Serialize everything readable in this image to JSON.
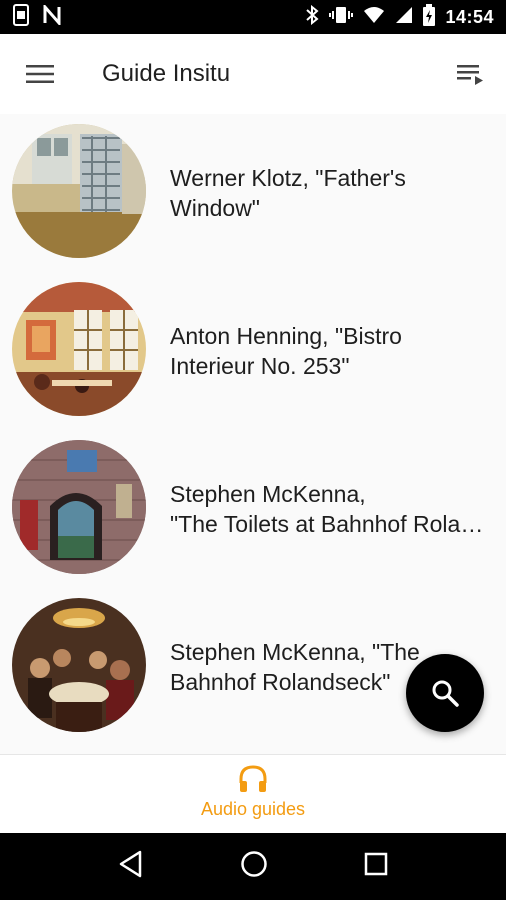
{
  "status_bar": {
    "time": "14:54",
    "icons": [
      "screenshot-icon",
      "n-icon",
      "bluetooth-icon",
      "vibrate-icon",
      "wifi-icon",
      "signal-icon",
      "battery-charging-icon"
    ]
  },
  "app_bar": {
    "title": "Guide Insitu",
    "menu_icon": "menu-icon",
    "playlist_icon": "playlist-icon"
  },
  "items": [
    {
      "line1": "Werner Klotz, \"Father's",
      "line2": "Window\""
    },
    {
      "line1": "Anton Henning, \"Bistro",
      "line2": "Interieur No. 253\""
    },
    {
      "line1": "Stephen McKenna,",
      "line2": "\"The Toilets at Bahnhof Rolandseck\""
    },
    {
      "line1": "Stephen McKenna, \"The",
      "line2": "Bahnhof Rolandseck\""
    }
  ],
  "fab": {
    "icon": "search-icon"
  },
  "bottom_nav": {
    "label": "Audio guides",
    "icon": "headphones-icon",
    "accent_color": "#f39c12"
  },
  "system_nav": [
    "back-icon",
    "home-icon",
    "recents-icon"
  ]
}
